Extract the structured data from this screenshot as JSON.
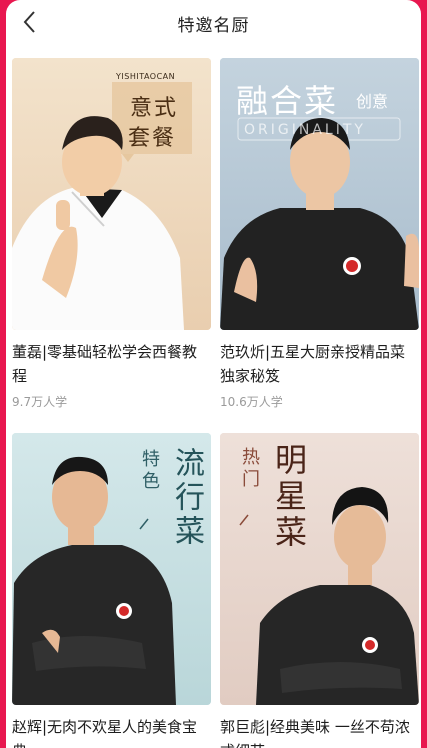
{
  "header": {
    "title": "特邀名厨"
  },
  "colors": {
    "accent": "#e8174f"
  },
  "icons": {
    "back": "chevron-left-icon",
    "logo": "chef-logo-badge"
  },
  "cards": [
    {
      "title": "董磊|零基础轻松学会西餐教程",
      "learners": "9.7万人学",
      "banner_en": "YISHITAOCAN",
      "banner_line1": "意式",
      "banner_line2": "套餐"
    },
    {
      "title": "范玖炘|五星大厨亲授精品菜独家秘笈",
      "learners": "10.6万人学",
      "banner_main": "融合菜",
      "banner_side": "创意",
      "banner_en": "ORIGINALITY"
    },
    {
      "title": "赵辉|无肉不欢星人的美食宝典",
      "learners": "",
      "banner_main": "流行菜",
      "banner_side": "特色"
    },
    {
      "title": "郭巨彪|经典美味 一丝不苟浓戎细节",
      "learners": "",
      "banner_main": "明星菜",
      "banner_side": "热门"
    }
  ]
}
